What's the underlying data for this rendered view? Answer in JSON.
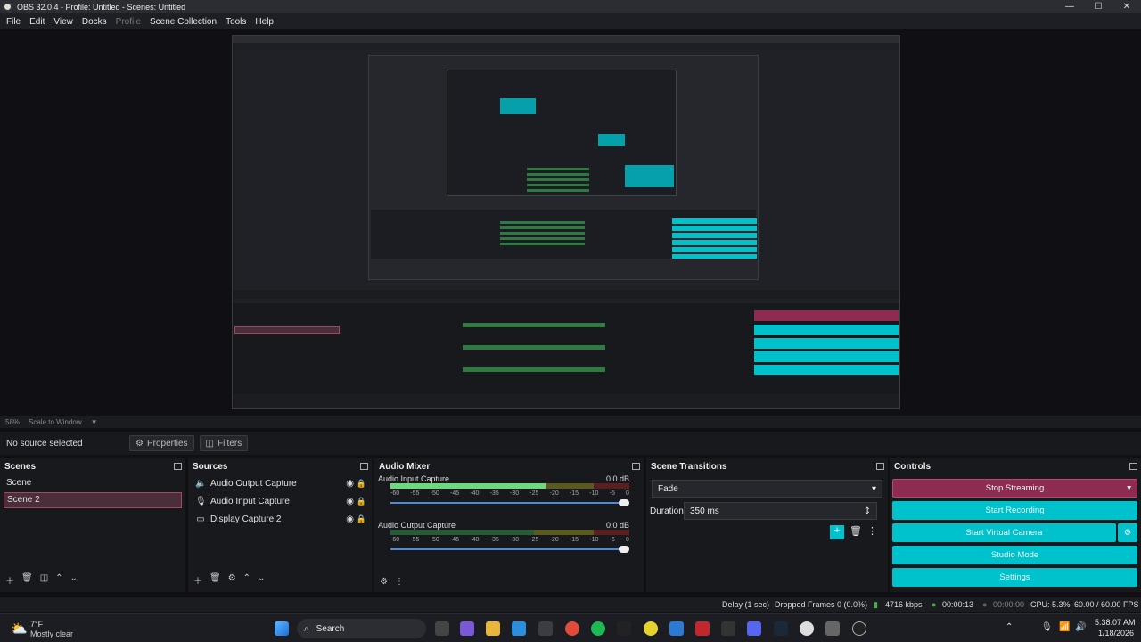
{
  "window": {
    "title": "OBS 32.0.4 - Profile: Untitled - Scenes: Untitled"
  },
  "menu": [
    "File",
    "Edit",
    "View",
    "Docks",
    "Profile",
    "Scene Collection",
    "Tools",
    "Help"
  ],
  "preview_status": {
    "zoom": "58%",
    "mode": "Scale to Window"
  },
  "prop_bar": {
    "no_source": "No source selected",
    "properties": "Properties",
    "filters": "Filters"
  },
  "scenes": {
    "title": "Scenes",
    "items": [
      "Scene",
      "Scene 2"
    ],
    "selected": "Scene 2"
  },
  "sources": {
    "title": "Sources",
    "items": [
      {
        "name": "Audio Output Capture",
        "icon": "speaker-icon"
      },
      {
        "name": "Audio Input Capture",
        "icon": "mic-icon"
      },
      {
        "name": "Display Capture 2",
        "icon": "monitor-icon"
      }
    ]
  },
  "mixer": {
    "title": "Audio Mixer",
    "channels": [
      {
        "name": "Audio Input Capture",
        "db": "0.0 dB",
        "level": 0.65
      },
      {
        "name": "Audio Output Capture",
        "db": "0.0 dB",
        "level": 0.0
      }
    ],
    "ticks": [
      "-60",
      "-55",
      "-50",
      "-45",
      "-40",
      "-35",
      "-30",
      "-25",
      "-20",
      "-15",
      "-10",
      "-5",
      "0"
    ]
  },
  "transitions": {
    "title": "Scene Transitions",
    "selected": "Fade",
    "duration_label": "Duration",
    "duration": "350 ms"
  },
  "controls": {
    "title": "Controls",
    "stop_streaming": "Stop Streaming",
    "start_recording": "Start Recording",
    "start_virtual_camera": "Start Virtual Camera",
    "studio_mode": "Studio Mode",
    "settings": "Settings"
  },
  "status": {
    "delay": "Delay (1 sec)",
    "dropped": "Dropped Frames 0 (0.0%)",
    "kbps": "4716 kbps",
    "stream_time": "00:00:13",
    "rec_time": "00:00:00",
    "cpu": "CPU: 5.3%",
    "fps": "60.00 / 60.00 FPS"
  },
  "taskbar": {
    "weather_temp": "7°F",
    "weather_desc": "Mostly clear",
    "search": "Search",
    "time": "5:38:07 AM",
    "date": "1/18/2026"
  },
  "colors": {
    "accent": "#00c2cc",
    "stop": "#8d2c50",
    "bg": "#18191d"
  }
}
